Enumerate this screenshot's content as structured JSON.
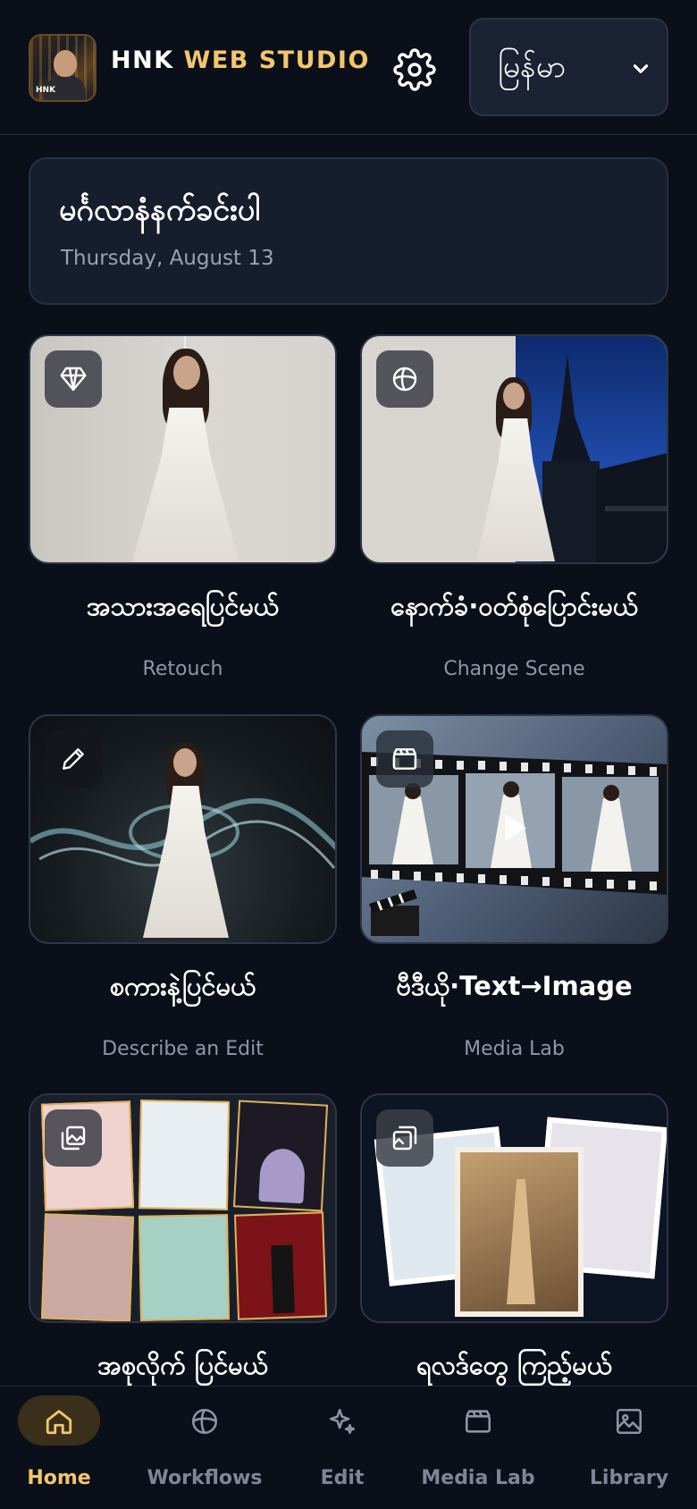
{
  "header": {
    "brand_white": "HNK",
    "brand_accent": "WEB STUDIO",
    "logo_text": "HNK",
    "language_value": "မြန်မာ",
    "icons": [
      "settings-gear-icon",
      "chevron-down-icon"
    ]
  },
  "greeting": {
    "title": "မင်္ဂလာနံနက်ခင်းပါ",
    "date": "Thursday, August 13"
  },
  "cards": [
    {
      "title": "အသားအရေပြင်မယ်",
      "subtitle": "Retouch",
      "icon": "gem-icon"
    },
    {
      "title": "နောက်ခံ·ဝတ်စုံပြောင်းမယ်",
      "subtitle": "Change Scene",
      "icon": "flower-icon"
    },
    {
      "title": "စကားနဲ့ပြင်မယ်",
      "subtitle": "Describe an Edit",
      "icon": "pencil-icon"
    },
    {
      "title": "ဗီဒီယို·Text→Image",
      "subtitle": "Media Lab",
      "icon": "clapper-icon"
    },
    {
      "title": "အစုလိုက် ပြင်မယ်",
      "subtitle": "",
      "icon": "images-icon"
    },
    {
      "title": "ရလဒ်တွေ ကြည့်မယ်",
      "subtitle": "",
      "icon": "gallery-icon"
    }
  ],
  "nav": {
    "items": [
      {
        "label": "Home",
        "icon": "home-icon",
        "active": true
      },
      {
        "label": "Workflows",
        "icon": "flower-icon",
        "active": false
      },
      {
        "label": "Edit",
        "icon": "sparkle-icon",
        "active": false
      },
      {
        "label": "Media Lab",
        "icon": "clapper-icon",
        "active": false
      },
      {
        "label": "Library",
        "icon": "image-icon",
        "active": false
      }
    ]
  },
  "colors": {
    "accent": "#f2c66d",
    "background": "#0b0f1a",
    "card": "#161d2c"
  }
}
